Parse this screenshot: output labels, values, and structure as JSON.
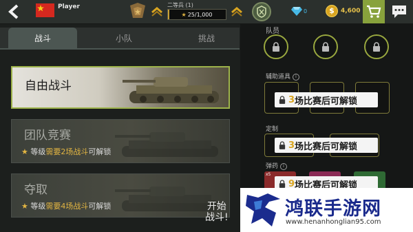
{
  "topbar": {
    "player_name": "Player",
    "rank_label": "二等兵 (1)",
    "xp_text": "25/1,000",
    "xp_progress": 0.025,
    "gems": "0",
    "coins": "4,600"
  },
  "tabs": [
    {
      "label": "战斗",
      "active": true
    },
    {
      "label": "小队",
      "active": false
    },
    {
      "label": "挑战",
      "active": false
    }
  ],
  "modes": [
    {
      "title": "自由战斗"
    },
    {
      "title": "团队竞赛",
      "req_prefix": "等级",
      "req_highlight": "需要2场战斗",
      "req_suffix": "可解锁"
    },
    {
      "title": "夺取",
      "req_prefix": "等级",
      "req_highlight": "需要4场战斗",
      "req_suffix": "可解锁"
    }
  ],
  "start_button": {
    "line1": "开始",
    "line2": "战斗!"
  },
  "right_panel": {
    "crew_label": "队员",
    "support_label": "辅助道具",
    "custom_label": "定制",
    "ammo_label": "弹药",
    "ammo_badge": "x5",
    "unlock_support": {
      "num": "3",
      "text": "场比赛后可解锁"
    },
    "unlock_custom": {
      "num": "3",
      "text": "场比赛后可解锁"
    },
    "unlock_ammo": {
      "num": "9",
      "text": "场比赛后可解锁"
    }
  },
  "watermark": {
    "title": "鸿联手游网",
    "url": "www.henanhonglian95.com"
  },
  "colors": {
    "accent_green": "#9db34a",
    "gold": "#d9a521",
    "gem_blue": "#47b9e6",
    "shop_green": "#88a23c"
  },
  "icons": [
    "back-arrow-icon",
    "flag-icon",
    "rank-insignia-icon",
    "chevron-up-icon",
    "clan-icon",
    "gem-icon",
    "coin-icon",
    "shopping-cart-icon",
    "chat-icon",
    "lock-icon",
    "star-icon",
    "info-icon"
  ]
}
